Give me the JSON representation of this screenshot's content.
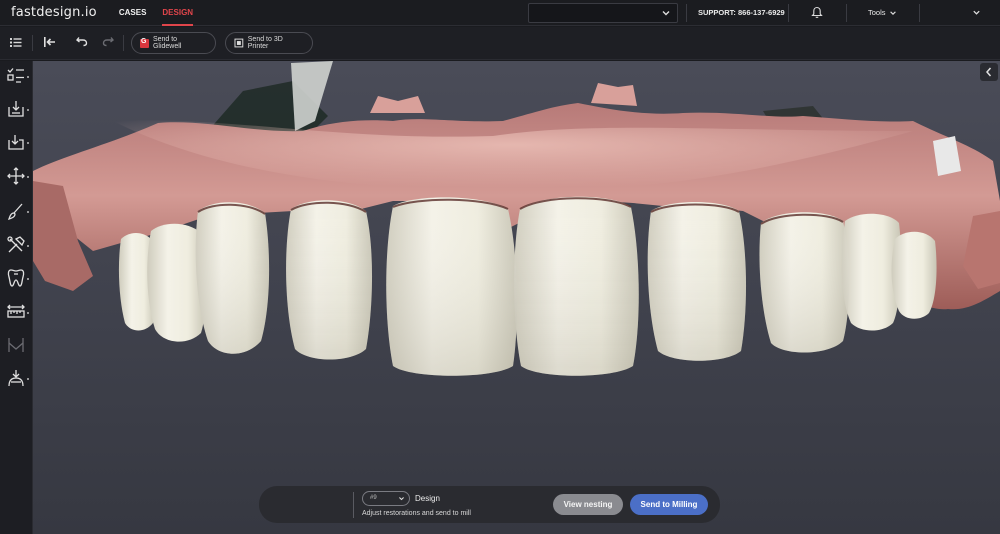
{
  "app": {
    "logo": "fastdesign.io",
    "nav": {
      "cases": "CASES",
      "design": "DESIGN"
    },
    "support": "SUPPORT: 866-137-6929",
    "tools": "Tools"
  },
  "toolbar": {
    "send_glidewell": "Send to Glidewell",
    "send_printer": "Send to 3D Printer"
  },
  "left_rail": {
    "icons": [
      "checklist-icon",
      "import-icon",
      "export-icon",
      "move-icon",
      "brush-icon",
      "tools-icon",
      "tooth-icon",
      "ruler-icon",
      "bridge-icon",
      "morph-icon"
    ]
  },
  "bottom": {
    "tooth_select": "#9",
    "step_title": "Design",
    "step_subtitle": "Adjust restorations and send to mill",
    "view_nesting": "View nesting",
    "send_milling": "Send to Milling"
  },
  "colors": {
    "accent_red": "#e0454b",
    "mill_blue": "#4b6fc7",
    "gum": "#c98a86",
    "tooth": "#eae8dc"
  }
}
